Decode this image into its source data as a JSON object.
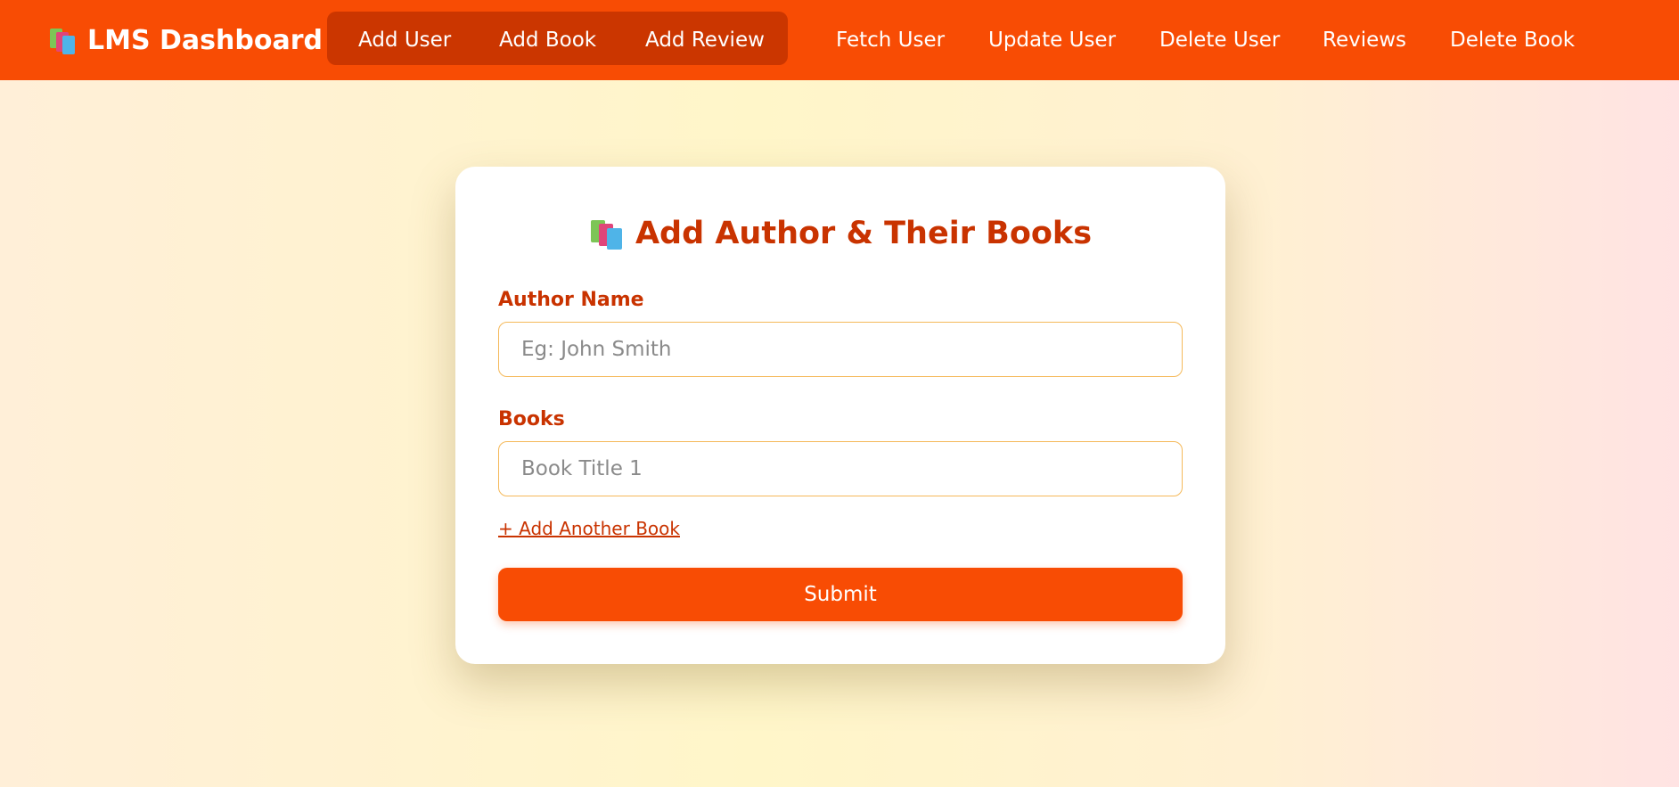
{
  "navbar": {
    "brand_icon": "books-icon",
    "brand_title": "LMS Dashboard",
    "group_links": [
      "Add User",
      "Add Book",
      "Add Review"
    ],
    "links": [
      "Fetch User",
      "Update User",
      "Delete User",
      "Reviews",
      "Delete Book"
    ]
  },
  "form": {
    "title_icon": "books-icon",
    "title": "Add Author & Their Books",
    "author_label": "Author Name",
    "author_placeholder": "Eg: John Smith",
    "books_label": "Books",
    "book_placeholder": "Book Title 1",
    "add_book_link": "+ Add Another Book",
    "submit_label": "Submit"
  },
  "colors": {
    "accent": "#f84c04",
    "accent_dark": "#cb3600",
    "heading": "#c93300",
    "input_border": "#f5b95a"
  }
}
